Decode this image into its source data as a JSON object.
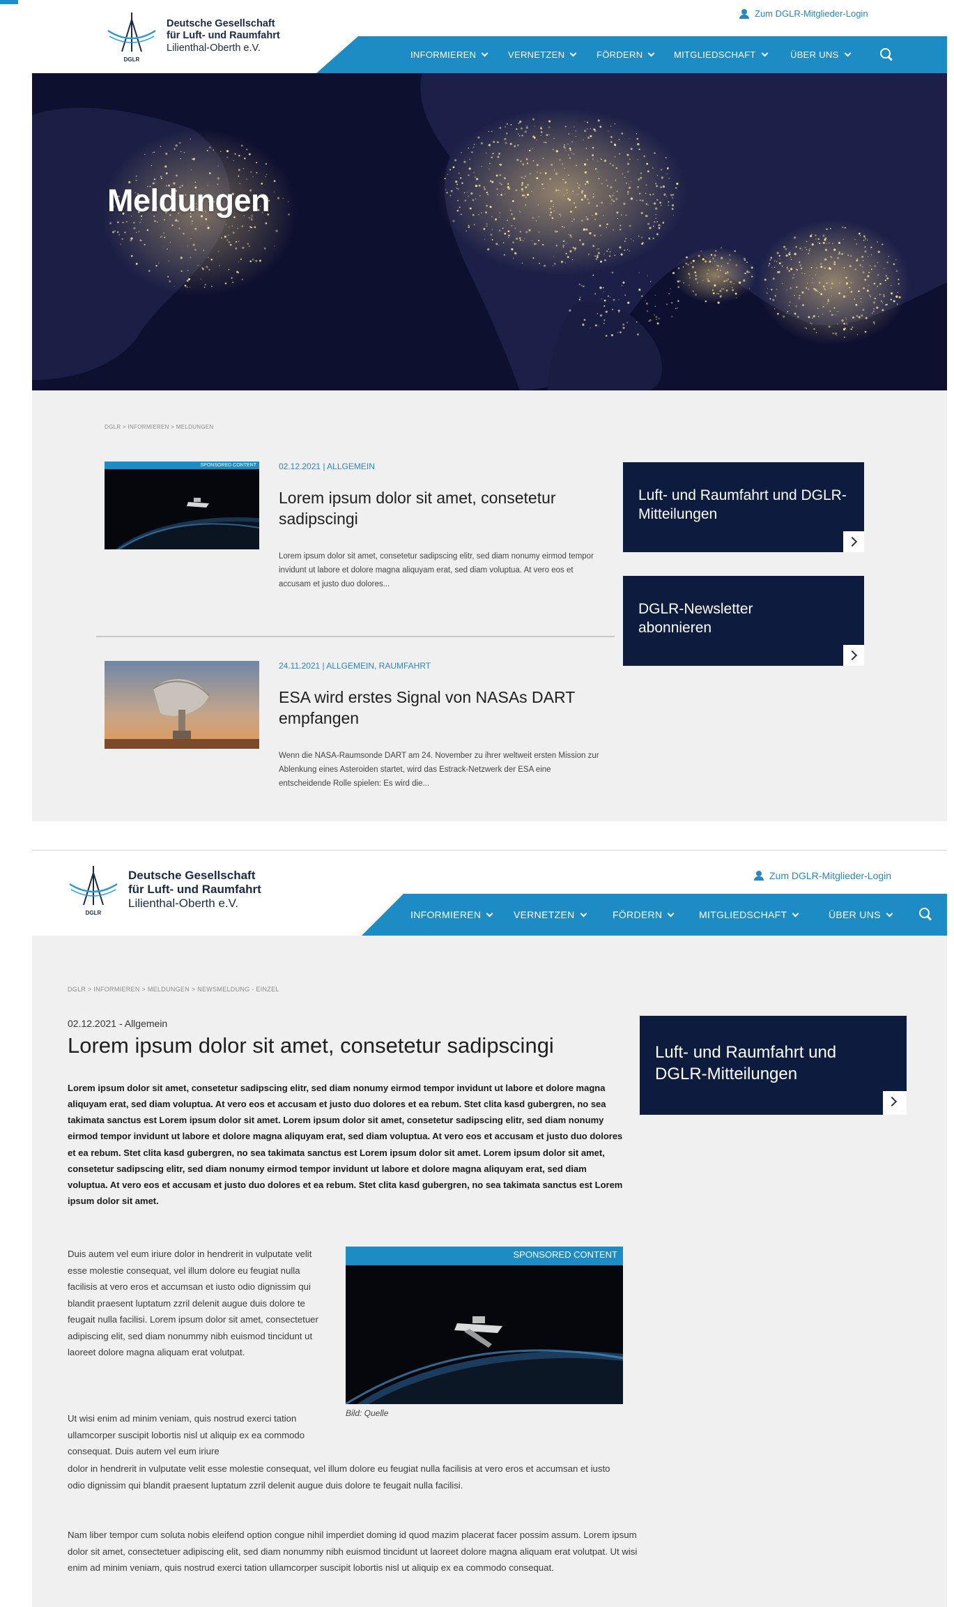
{
  "login_link": "Zum DGLR-Mitglieder-Login",
  "logo": {
    "line1": "Deutsche Gesellschaft",
    "line2": "für Luft- und Raumfahrt",
    "line3": "Lilienthal-Oberth e.V.",
    "mark_label": "DGLR",
    "icon": "dglr-logo-icon"
  },
  "nav": {
    "items": [
      "INFORMIEREN",
      "VERNETZEN",
      "FÖRDERN",
      "MITGLIEDSCHAFT",
      "ÜBER UNS"
    ],
    "search_icon": "search-icon"
  },
  "colors": {
    "accent": "#1e8cc4",
    "navy": "#0d1b3e",
    "background": "#f0f0f1",
    "link": "#2a86c2"
  },
  "listing_page": {
    "hero_title": "Meldungen",
    "breadcrumb": "DGLR > INFORMIEREN > MELDUNGEN",
    "posts": [
      {
        "meta": "02.12.2021 | ALLGEMEIN",
        "sponsored": "SPONSORED CONTENT",
        "title": "Lorem ipsum dolor sit amet, consetetur sadipscingi",
        "excerpt": "Lorem ipsum dolor sit amet, consetetur sadipscing elitr, sed diam nonumy eirmod tempor invidunt ut labore et dolore magna aliquyam erat, sed diam voluptua. At vero eos et accusam et justo duo dolores..."
      },
      {
        "meta": "24.11.2021 | ALLGEMEIN, RAUMFAHRT",
        "title": "ESA wird erstes Signal von NASAs DART empfangen",
        "excerpt": "Wenn die NASA-Raumsonde DART am 24. November zu ihrer weltweit ersten Mission zur Ablenkung eines Asteroiden startet, wird das Estrack-Netzwerk der ESA eine entscheidende Rolle spielen: Es wird die..."
      }
    ],
    "sidebar": [
      {
        "title": "Luft- und Raumfahrt und DGLR-Mitteilungen"
      },
      {
        "title": "DGLR-Newsletter abonnieren"
      }
    ]
  },
  "article_page": {
    "breadcrumb": "DGLR > INFORMIEREN > MELDUNGEN > NEWSMELDUNG - EINZEL",
    "meta": "02.12.2021 - Allgemein",
    "title": "Lorem ipsum dolor sit amet, consetetur sadipscingi",
    "lead": "Lorem ipsum dolor sit amet, consetetur sadipscing elitr, sed diam nonumy eirmod tempor invidunt ut labore et dolore magna aliquyam erat, sed diam voluptua. At vero eos et accusam et justo duo dolores et ea rebum. Stet clita kasd gubergren, no sea takimata sanctus est Lorem ipsum dolor sit amet. Lorem ipsum dolor sit amet, consetetur sadipscing elitr, sed diam nonumy eirmod tempor invidunt ut labore et dolore magna aliquyam erat, sed diam voluptua. At vero eos et accusam et justo duo dolores et ea rebum. Stet clita kasd gubergren, no sea takimata sanctus est Lorem ipsum dolor sit amet. Lorem ipsum dolor sit amet, consetetur sadipscing elitr, sed diam nonumy eirmod tempor invidunt ut labore et dolore magna aliquyam erat, sed diam voluptua. At vero eos et accusam et justo duo dolores et ea rebum. Stet clita kasd gubergren, no sea takimata sanctus est Lorem ipsum dolor sit amet.",
    "para1": "Duis autem vel eum iriure dolor in hendrerit in vulputate velit esse molestie consequat, vel illum dolore eu feugiat nulla facilisis at vero eros et accumsan et iusto odio dignissim qui blandit praesent luptatum zzril delenit augue duis dolore te feugait nulla facilisi. Lorem ipsum dolor sit amet, consectetuer adipiscing elit, sed diam nonummy nibh euismod tincidunt ut laoreet dolore magna aliquam erat volutpat.",
    "para2_top": "Ut wisi enim ad minim veniam, quis nostrud exerci tation ullamcorper suscipit lobortis nisl ut aliquip ex ea commodo consequat. Duis autem vel eum iriure",
    "para2_bottom": "dolor in hendrerit in vulputate velit esse molestie consequat, vel illum dolore eu feugiat nulla facilisis at vero eros et accumsan et iusto odio dignissim qui blandit praesent luptatum zzril delenit augue duis dolore te feugait nulla facilisi.",
    "para3": "Nam liber tempor cum soluta nobis eleifend option congue nihil imperdiet doming id quod mazim placerat facer possim assum. Lorem ipsum dolor sit amet, consectetuer adipiscing elit, sed diam nonummy nibh euismod tincidunt ut laoreet dolore magna aliquam erat volutpat. Ut wisi enim ad minim veniam, quis nostrud exerci tation ullamcorper suscipit lobortis nisl ut aliquip ex ea commodo consequat.",
    "figure_sponsored": "SPONSORED CONTENT",
    "figure_caption": "Bild: Quelle",
    "sidebar_title": "Luft- und Raumfahrt und DGLR-Mitteilungen"
  }
}
